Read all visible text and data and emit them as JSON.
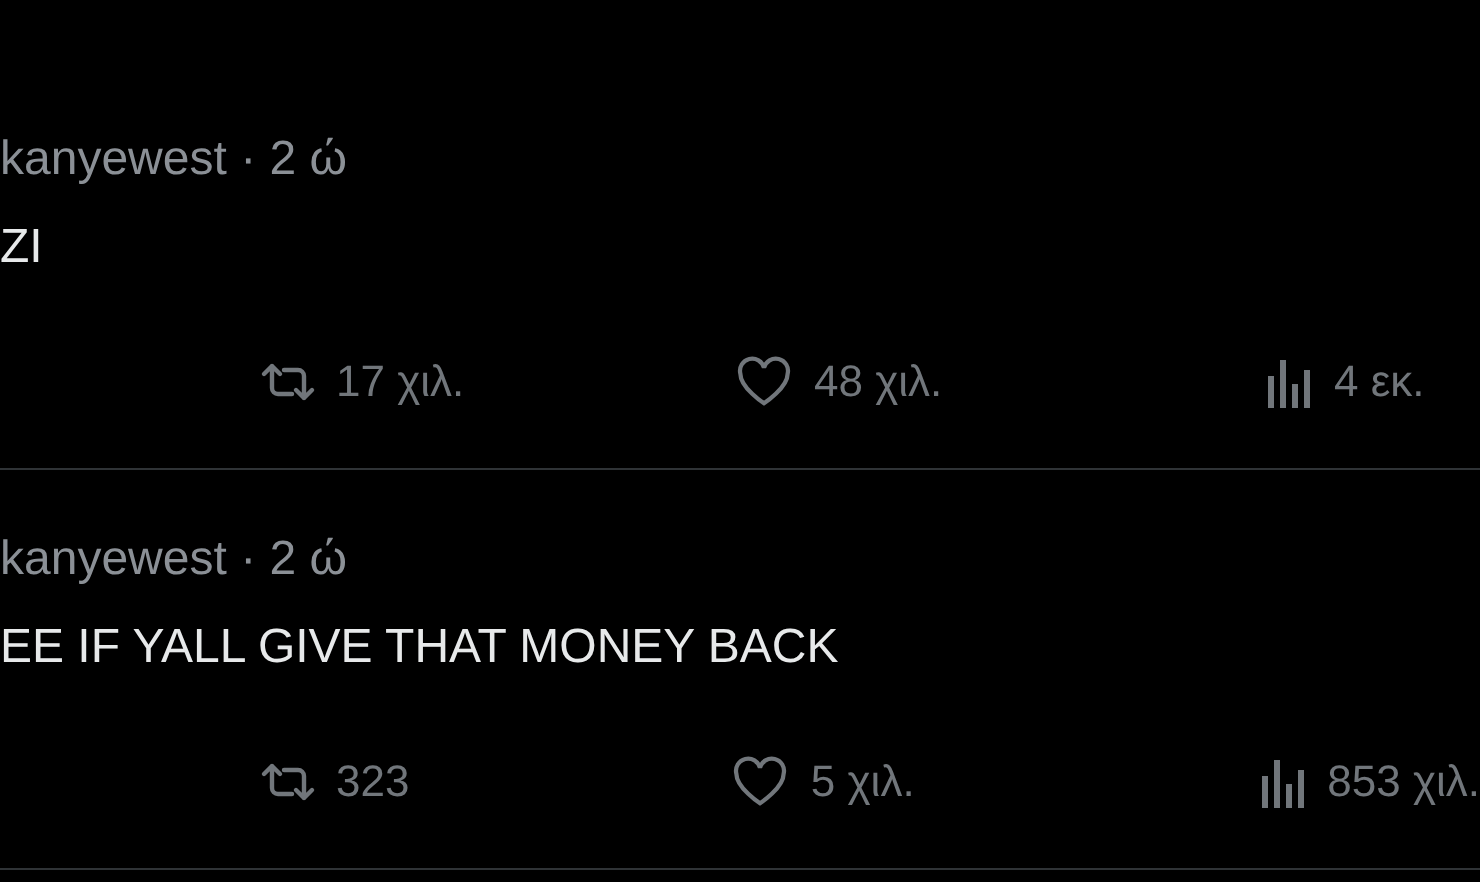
{
  "tweets": [
    {
      "author": "kanyewest",
      "separator": "·",
      "time": "2 ώ",
      "text": "ZI",
      "retweets": "17 χιλ.",
      "likes": "48 χιλ.",
      "views": "4 εκ."
    },
    {
      "author": "kanyewest",
      "separator": "·",
      "time": "2 ώ",
      "text": "EE IF YALL GIVE THAT MONEY BACK",
      "retweets": "323",
      "likes": "5 χιλ.",
      "views": "853 χιλ."
    }
  ]
}
